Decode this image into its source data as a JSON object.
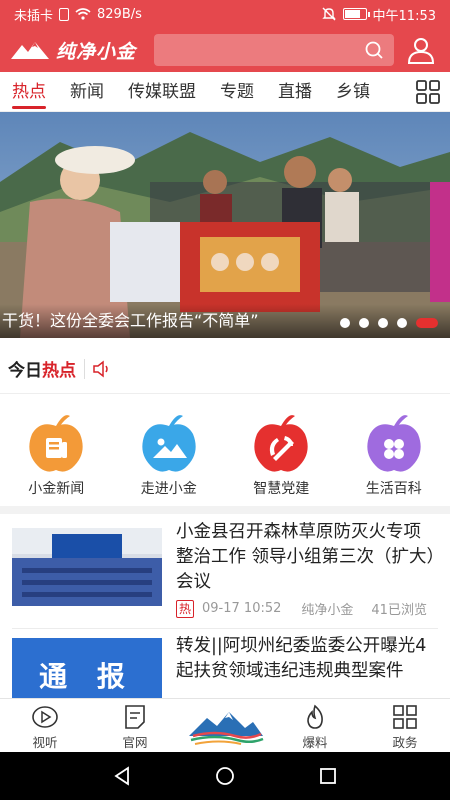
{
  "status_bar": {
    "carrier": "未插卡",
    "network_speed": "829B/s",
    "time": "中午11:53"
  },
  "header": {
    "logo_text": "纯净小金",
    "search_placeholder": ""
  },
  "tabs": [
    {
      "label": "热点",
      "active": true
    },
    {
      "label": "新闻",
      "active": false
    },
    {
      "label": "传媒联盟",
      "active": false
    },
    {
      "label": "专题",
      "active": false
    },
    {
      "label": "直播",
      "active": false
    },
    {
      "label": "乡镇",
      "active": false
    }
  ],
  "banner": {
    "caption": "干货！这份全委会工作报告“不简单”",
    "slides": 5,
    "active_slide": 5
  },
  "hot_section": {
    "title_prefix": "今日",
    "title_accent": "热点"
  },
  "quick_apps": [
    {
      "label": "小金新闻",
      "color": "#f39a38",
      "icon": "newspaper-icon"
    },
    {
      "label": "走进小金",
      "color": "#3aa7e8",
      "icon": "landscape-icon"
    },
    {
      "label": "智慧党建",
      "color": "#e5302f",
      "icon": "party-emblem-icon"
    },
    {
      "label": "生活百科",
      "color": "#9f6bdf",
      "icon": "clover-icon"
    }
  ],
  "news": [
    {
      "title": "小金县召开森林草原防灭火专项整治工作 领导小组第三次（扩大）会议",
      "tag": "热",
      "time": "09-17 10:52",
      "source": "纯净小金",
      "views": "41已浏览"
    },
    {
      "title": "转发||阿坝州纪委监委公开曝光4起扶贫领域违纪违规典型案件",
      "thumb_text": "通 报"
    }
  ],
  "bottom_nav": [
    {
      "label": "视听",
      "icon": "play-circle-icon"
    },
    {
      "label": "官网",
      "icon": "document-icon"
    },
    {
      "label": "",
      "icon": "mountain-logo-icon"
    },
    {
      "label": "爆料",
      "icon": "flame-icon"
    },
    {
      "label": "政务",
      "icon": "grid-icon"
    }
  ],
  "colors": {
    "brand_red": "#e5484d",
    "accent_red": "#d8232a"
  }
}
